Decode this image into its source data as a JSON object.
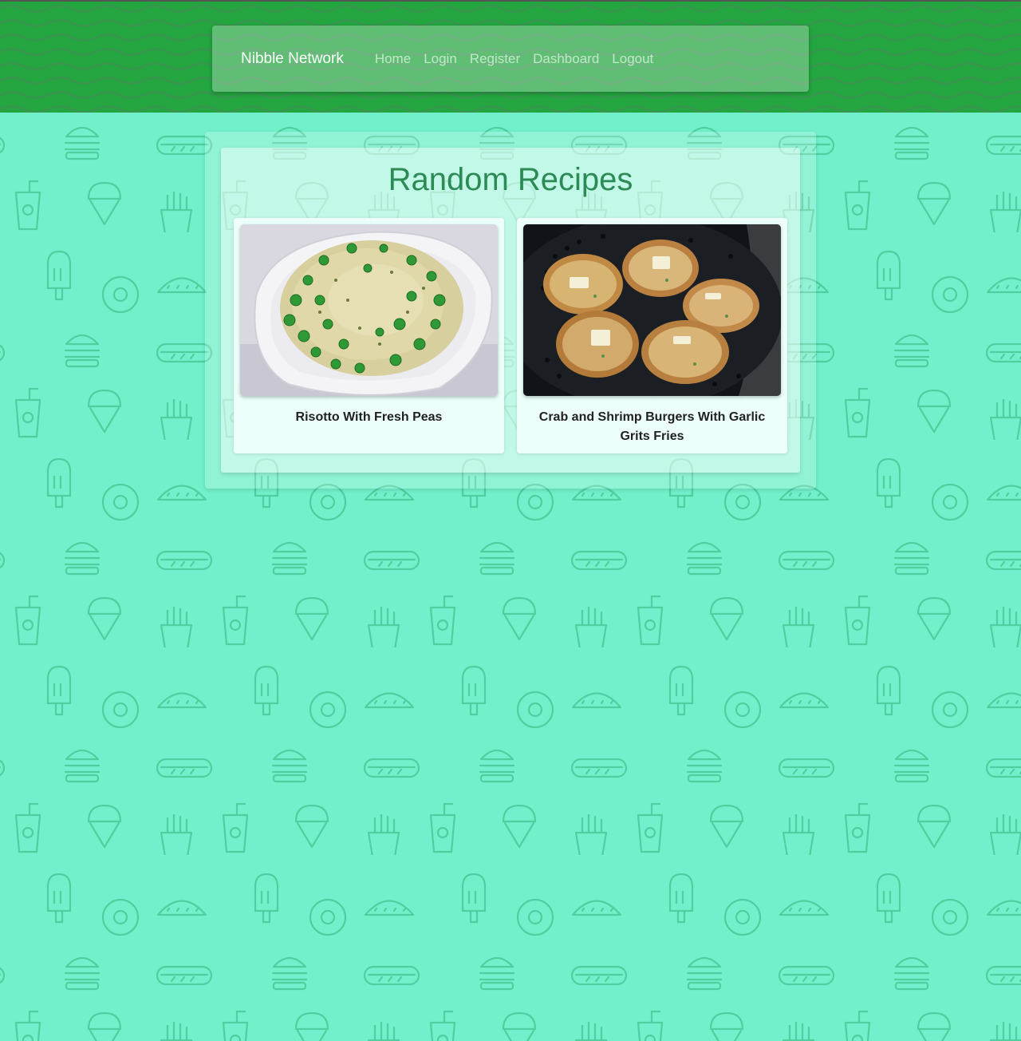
{
  "nav": {
    "brand": "Nibble Network",
    "links": [
      "Home",
      "Login",
      "Register",
      "Dashboard",
      "Logout"
    ]
  },
  "main": {
    "title": "Random Recipes",
    "recipes": [
      {
        "title": "Risotto With Fresh Peas",
        "image": "risotto-photo"
      },
      {
        "title": "Crab and Shrimp Burgers With Garlic Grits Fries",
        "image": "crab-burgers-photo"
      }
    ]
  },
  "colors": {
    "header": "#23a63f",
    "background": "#72f0cb",
    "title": "#2c8a54"
  }
}
